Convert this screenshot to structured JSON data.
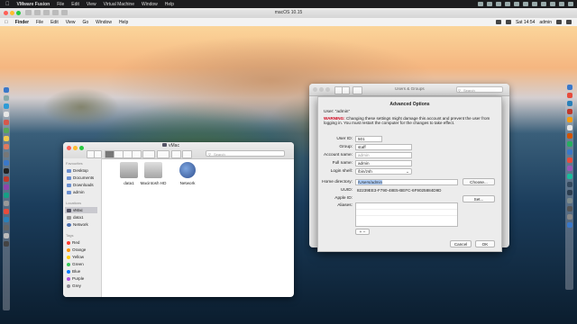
{
  "host_menubar": {
    "app_name": "VMware Fusion",
    "items": [
      "File",
      "Edit",
      "View",
      "Virtual Machine",
      "Window",
      "Help"
    ]
  },
  "vm_window": {
    "title": "macOS 10.15"
  },
  "guest_menubar": {
    "app_name": "Finder",
    "items": [
      "File",
      "Edit",
      "View",
      "Go",
      "Window",
      "Help"
    ],
    "clock": "Sat 14:54",
    "user": "admin"
  },
  "finder": {
    "title": "vMac",
    "search_placeholder": "Search",
    "sidebar": {
      "favorites_header": "Favourites",
      "favorites": [
        "Desktop",
        "Documents",
        "Downloads",
        "admin"
      ],
      "locations_header": "Locations",
      "locations": [
        "vMac",
        "data1",
        "Network"
      ],
      "tags_header": "Tags",
      "tags": [
        {
          "label": "Red",
          "color": "#ff3b30"
        },
        {
          "label": "Orange",
          "color": "#ff9500"
        },
        {
          "label": "Yellow",
          "color": "#ffcc00"
        },
        {
          "label": "Green",
          "color": "#34c759"
        },
        {
          "label": "Blue",
          "color": "#007aff"
        },
        {
          "label": "Purple",
          "color": "#af52de"
        },
        {
          "label": "Grey",
          "color": "#8e8e93"
        }
      ]
    },
    "items": [
      "data1",
      "Macintosh HD",
      "Network"
    ]
  },
  "users_groups": {
    "title": "Users & Groups",
    "search_placeholder": "Search"
  },
  "advanced_options": {
    "heading": "Advanced Options",
    "user_line": "User: “admin”",
    "warning_label": "WARNING:",
    "warning_text": "Changing these settings might damage this account and prevent the user from logging in. You must restart the computer for the changes to take effect.",
    "fields": {
      "user_id_label": "User ID:",
      "user_id": "501",
      "group_label": "Group:",
      "group": "staff",
      "account_name_label": "Account name:",
      "account_name": "admin",
      "full_name_label": "Full name:",
      "full_name": "admin",
      "login_shell_label": "Login shell:",
      "login_shell": "/bin/zsh",
      "home_directory_label": "Home directory:",
      "home_directory": "/Users/admin",
      "uuid_label": "UUID:",
      "uuid": "82239EE3-F790-48E5-BEFC-6F9025884D9D",
      "apple_id_label": "Apple ID:",
      "aliases_label": "Aliases:"
    },
    "buttons": {
      "choose": "Choose...",
      "set": "Set...",
      "add_remove": "+  −",
      "cancel": "Cancel",
      "ok": "OK"
    }
  }
}
